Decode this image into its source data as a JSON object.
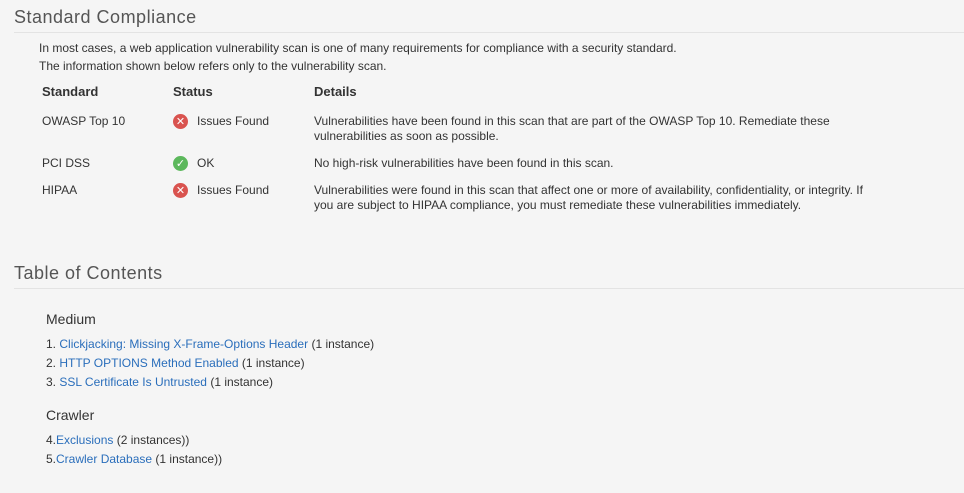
{
  "compliance": {
    "title": "Standard Compliance",
    "intro_line1": "In most cases, a web application vulnerability scan is one of many requirements for compliance with a security standard.",
    "intro_line2": "The information shown below refers only to the vulnerability scan.",
    "headers": {
      "standard": "Standard",
      "status": "Status",
      "details": "Details"
    },
    "rows": [
      {
        "standard": "OWASP Top 10",
        "status": "Issues Found",
        "status_icon": "x-circle-icon",
        "details_line1": "Vulnerabilities have been found in this scan that are part of the OWASP Top 10. Remediate these",
        "details_line2": "vulnerabilities as soon as possible."
      },
      {
        "standard": "PCI DSS",
        "status": "OK",
        "status_icon": "check-circle-icon",
        "details_line1": "No high-risk vulnerabilities have been found in this scan.",
        "details_line2": ""
      },
      {
        "standard": "HIPAA",
        "status": "Issues Found",
        "status_icon": "x-circle-icon",
        "details_line1": "Vulnerabilities were found in this scan that affect one or more of availability, confidentiality, or integrity. If",
        "details_line2": "you are subject to HIPAA compliance, you must remediate these vulnerabilities immediately."
      }
    ]
  },
  "toc": {
    "title": "Table of Contents",
    "groups": [
      {
        "heading": "Medium",
        "items": [
          {
            "number": "1.",
            "link": "Clickjacking: Missing X-Frame-Options Header",
            "count": "(1 instance)"
          },
          {
            "number": "2.",
            "link": "HTTP OPTIONS Method Enabled",
            "count": "(1 instance)"
          },
          {
            "number": "3.",
            "link": "SSL Certificate Is Untrusted",
            "count": "(1 instance)"
          }
        ]
      },
      {
        "heading": "Crawler",
        "items": [
          {
            "number": "4.",
            "link": "Exclusions",
            "count": "(2 instances))"
          },
          {
            "number": "5.",
            "link": "Crawler Database",
            "count": "(1 instance))"
          }
        ]
      }
    ]
  },
  "colors": {
    "background": "#f5f5f5",
    "link": "#2a6ebb",
    "fail": "#d9534f",
    "ok": "#5cb85c"
  }
}
